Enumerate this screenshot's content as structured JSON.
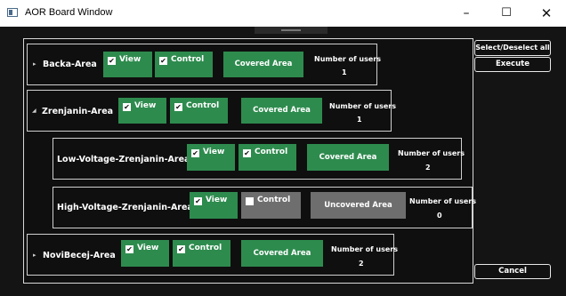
{
  "window": {
    "title": "AOR Board Window",
    "minimize_glyph": "–",
    "maximize_glyph": "☐",
    "close_glyph": "✕"
  },
  "areas": [
    {
      "name": "Backa-Area",
      "expander": "▸",
      "view": {
        "checked": true,
        "label": "View"
      },
      "control": {
        "checked": true,
        "label": "Control"
      },
      "coverage": {
        "label": "Covered Area",
        "covered": true
      },
      "users_label": "Number of users",
      "users_count": "1"
    },
    {
      "name": "Zrenjanin-Area",
      "expander": "◢",
      "view": {
        "checked": true,
        "label": "View"
      },
      "control": {
        "checked": true,
        "label": "Control"
      },
      "coverage": {
        "label": "Covered Area",
        "covered": true
      },
      "users_label": "Number of users",
      "users_count": "1"
    },
    {
      "name": "Low-Voltage-Zrenjanin-Area",
      "view": {
        "checked": true,
        "label": "View"
      },
      "control": {
        "checked": true,
        "label": "Control"
      },
      "coverage": {
        "label": "Covered Area",
        "covered": true
      },
      "users_label": "Number of users",
      "users_count": "2"
    },
    {
      "name": "High-Voltage-Zrenjanin-Area",
      "view": {
        "checked": true,
        "label": "View"
      },
      "control": {
        "checked": false,
        "label": "Control"
      },
      "coverage": {
        "label": "Uncovered Area",
        "covered": false
      },
      "users_label": "Number of users",
      "users_count": "0"
    },
    {
      "name": "NoviBecej-Area",
      "expander": "▸",
      "view": {
        "checked": true,
        "label": "View"
      },
      "control": {
        "checked": true,
        "label": "Control"
      },
      "coverage": {
        "label": "Covered Area",
        "covered": true
      },
      "users_label": "Number of users",
      "users_count": "2"
    }
  ],
  "actions": {
    "select_all": "Select/Deselect all",
    "execute": "Execute",
    "cancel": "Cancel"
  },
  "checkmark": "✔",
  "colors": {
    "covered": "#2e8b4e",
    "uncovered": "#6e6e6e",
    "background": "#141414"
  }
}
